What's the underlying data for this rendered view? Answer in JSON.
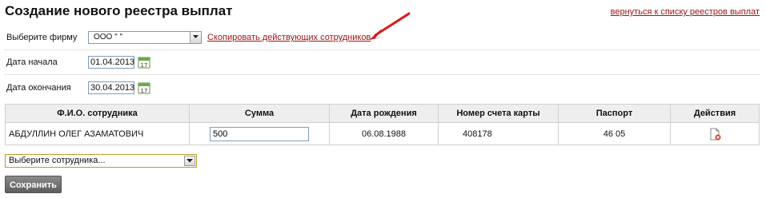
{
  "page": {
    "title": "Создание нового реестра выплат",
    "back_link": "вернуться к списку реестров выплат"
  },
  "form": {
    "company_label": "Выберите фирму",
    "company_value": "ООО \"                    \"",
    "copy_link": "Скопировать действующих сотрудников",
    "start_label": "Дата начала",
    "start_value": "01.04.2013",
    "end_label": "Дата окончания",
    "end_value": "30.04.2013"
  },
  "table": {
    "headers": [
      "Ф.И.О. сотрудника",
      "Сумма",
      "Дата рождения",
      "Номер счета карты",
      "Паспорт",
      "Действия"
    ],
    "rows": [
      {
        "name": "АБДУЛЛИН ОЛЕГ АЗАМАТОВИЧ",
        "amount": "500",
        "birth_date": "06.08.1988",
        "card": "408178",
        "passport": "46 05"
      }
    ]
  },
  "employee_select": {
    "value": "Выберите сотрудника..."
  },
  "save_label": "Сохранить",
  "colors": {
    "link": "#a01515",
    "arrow": "#d81b1b",
    "header_bg": "#eeeeee"
  },
  "icons": {
    "calendar": "calendar-icon",
    "delete": "delete-document-icon",
    "dropdown": "chevron-down-icon"
  }
}
